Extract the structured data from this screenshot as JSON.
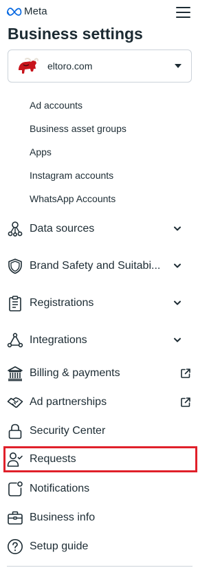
{
  "brand": {
    "name": "Meta"
  },
  "page": {
    "title": "Business settings"
  },
  "business": {
    "name": "eltoro.com"
  },
  "subitems": [
    "Ad accounts",
    "Business asset groups",
    "Apps",
    "Instagram accounts",
    "WhatsApp Accounts"
  ],
  "nav": {
    "data_sources": "Data sources",
    "brand_safety": "Brand Safety and Suitabi...",
    "registrations": "Registrations",
    "integrations": "Integrations",
    "billing": "Billing & payments",
    "ad_partnerships": "Ad partnerships",
    "security_center": "Security Center",
    "requests": "Requests",
    "notifications": "Notifications",
    "business_info": "Business info",
    "setup_guide": "Setup guide"
  },
  "colors": {
    "highlight": "#e0202a",
    "text": "#1c2b33",
    "meta_blue": "#0668e1"
  },
  "selected_item": "requests"
}
